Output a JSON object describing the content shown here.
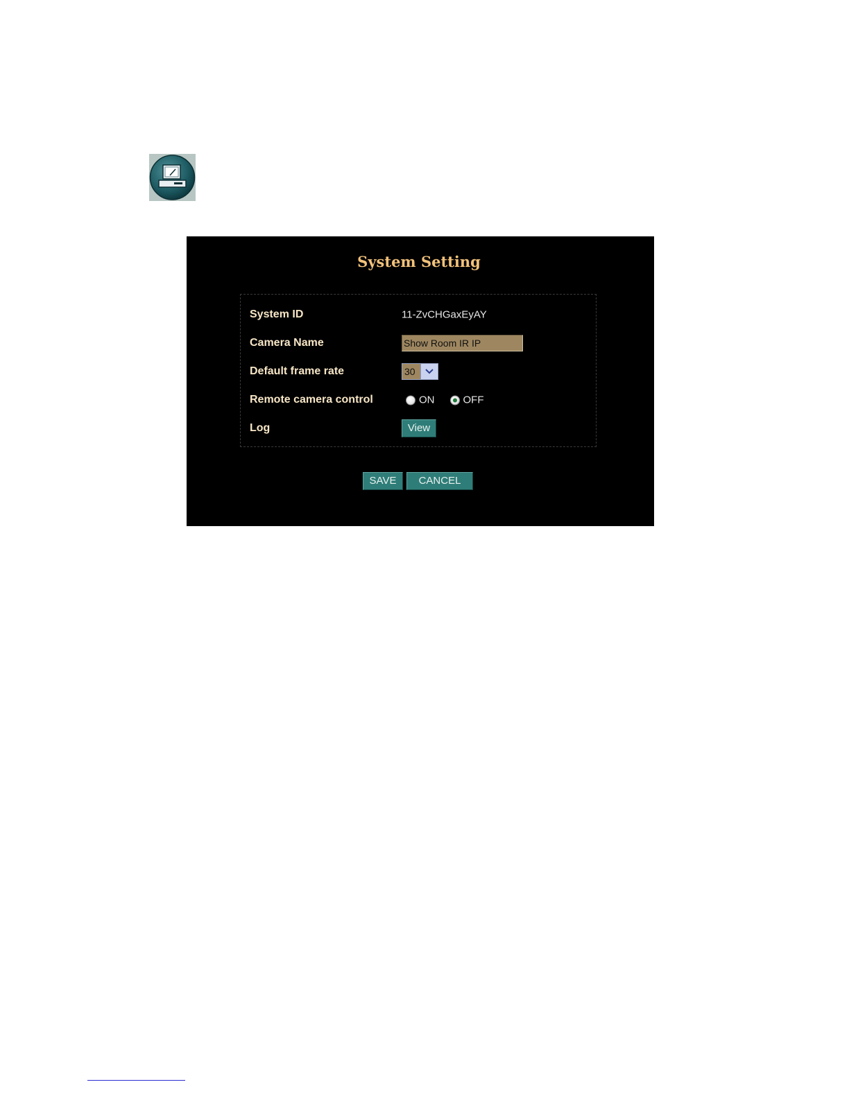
{
  "page": {
    "icon": "computer-monitor-icon"
  },
  "panel": {
    "title": "System Setting",
    "colors": {
      "background": "#000000",
      "title": "#f2c27b",
      "label": "#f7e6c6",
      "button": "#2f7d78",
      "input": "#9e8760"
    },
    "fields": {
      "system_id": {
        "label": "System ID",
        "value": "11-ZvCHGaxEyAY"
      },
      "camera_name": {
        "label": "Camera Name",
        "value": "Show Room IR IP"
      },
      "frame_rate": {
        "label": "Default frame rate",
        "selected": "30",
        "icon": "chevron-down-icon"
      },
      "remote_control": {
        "label": "Remote camera control",
        "options": [
          {
            "label": "ON",
            "checked": false
          },
          {
            "label": "OFF",
            "checked": true
          }
        ]
      },
      "log": {
        "label": "Log",
        "button": "View"
      }
    },
    "actions": {
      "save": "SAVE",
      "cancel": "CANCEL"
    }
  }
}
